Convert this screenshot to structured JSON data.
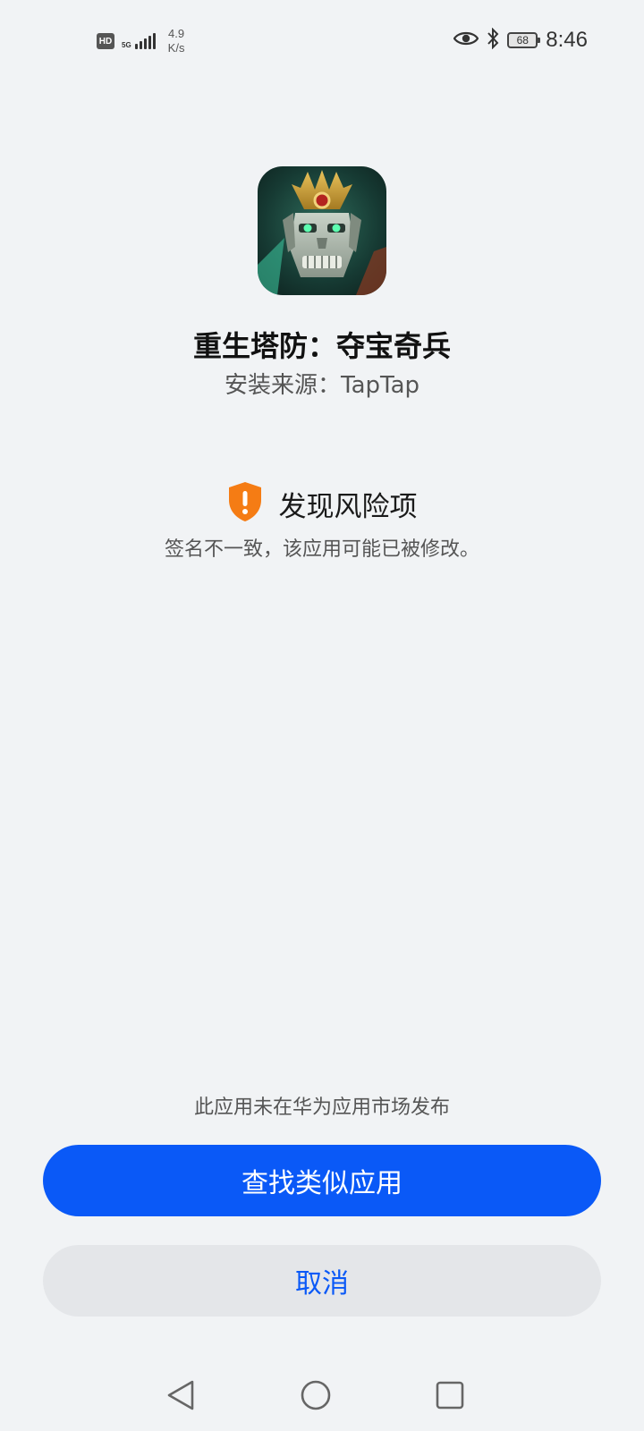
{
  "status_bar": {
    "hd": "HD",
    "network": "5G",
    "net_speed_value": "4.9",
    "net_speed_unit": "K/s",
    "battery": "68",
    "time": "8:46"
  },
  "app": {
    "name": "重生塔防：夺宝奇兵",
    "install_source": "安装来源：TapTap"
  },
  "risk": {
    "title": "发现风险项",
    "description": "签名不一致，该应用可能已被修改。",
    "color": "#f57c14"
  },
  "market_note": "此应用未在华为应用市场发布",
  "buttons": {
    "find_similar": "查找类似应用",
    "cancel": "取消"
  },
  "colors": {
    "background": "#f1f3f5",
    "primary": "#0a59f7",
    "secondary_button": "#e4e6e9"
  }
}
